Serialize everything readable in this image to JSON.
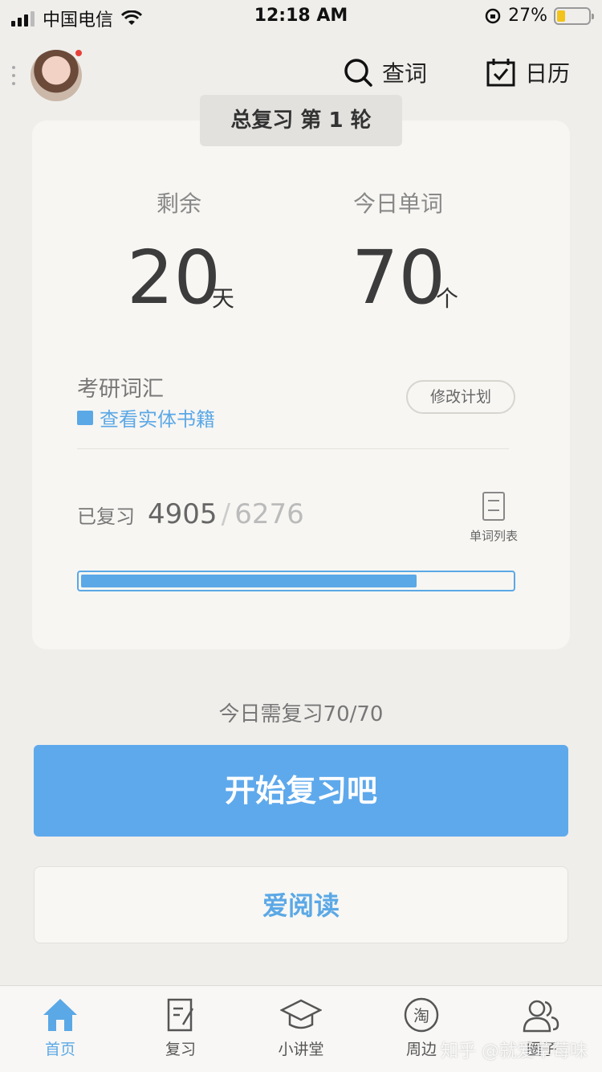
{
  "status_bar": {
    "carrier": "中国电信",
    "time": "12:18 AM",
    "battery": "27%"
  },
  "header": {
    "search_label": "查词",
    "calendar_label": "日历"
  },
  "plan": {
    "round_label": "总复习 第 1 轮",
    "remaining_label": "剩余",
    "remaining_value": "20",
    "remaining_unit": "天",
    "today_words_label": "今日单词",
    "today_words_value": "70",
    "today_words_unit": "个",
    "book_name": "考研词汇",
    "book_link": "查看实体书籍",
    "modify_plan": "修改计划",
    "reviewed_label": "已复习",
    "reviewed_done": "4905",
    "separator": "/",
    "reviewed_total": "6276",
    "word_list_label": "单词列表",
    "progress_fraction": 0.78
  },
  "today_need": "今日需复习70/70",
  "start_button": "开始复习吧",
  "read_button": "爱阅读",
  "tabbar": {
    "items": [
      {
        "label": "首页",
        "icon": "home-icon",
        "active": true
      },
      {
        "label": "复习",
        "icon": "review-icon",
        "active": false
      },
      {
        "label": "小讲堂",
        "icon": "graduation-cap-icon",
        "active": false
      },
      {
        "label": "周边",
        "icon": "taobao-icon",
        "active": false
      },
      {
        "label": "圈子",
        "icon": "users-icon",
        "active": false
      }
    ]
  },
  "watermark": "知乎 @就爱草莓味",
  "colors": {
    "accent": "#5EA9EC",
    "background": "#EFEEEB",
    "card": "#F7F6F3",
    "battery": "#F2C31A",
    "badge": "#E8413B"
  }
}
